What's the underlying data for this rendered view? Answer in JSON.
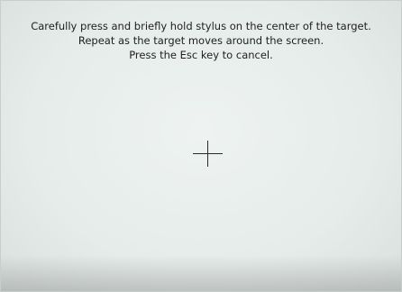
{
  "calibration": {
    "instructions": [
      "Carefully press and briefly hold stylus on the center of the target.",
      "Repeat as the target moves around the screen.",
      "Press the Esc key to cancel."
    ],
    "target_icon": "crosshair-icon"
  },
  "colors": {
    "background": "#e9efec",
    "text": "#1e1e1e",
    "crosshair": "#2a2a2a"
  }
}
